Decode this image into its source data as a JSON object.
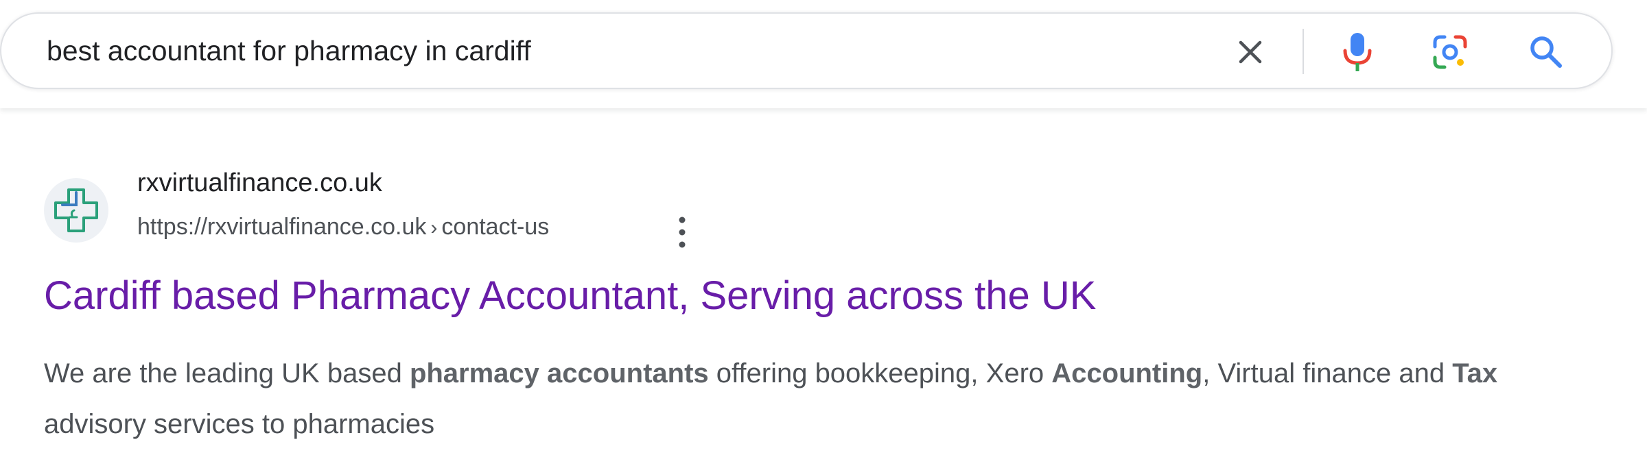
{
  "search": {
    "query": "best accountant for pharmacy in cardiff"
  },
  "icons": {
    "clear": "close-icon",
    "voice": "microphone-icon",
    "lens": "camera-lens-icon",
    "search": "search-icon",
    "more": "more-vert-icon",
    "favicon": "pharmacy-cross-icon"
  },
  "colors": {
    "visited_link": "#681da8",
    "search_icon": "#4285f4",
    "snippet_text": "#4d5156"
  },
  "result": {
    "site_name": "rxvirtualfinance.co.uk",
    "url_base": "https://rxvirtualfinance.co.uk",
    "url_separator": "›",
    "url_path": "contact-us",
    "title": "Cardiff based Pharmacy Accountant, Serving across the UK",
    "snippet": {
      "p1": "We are the leading UK based ",
      "b1": "pharmacy accountants",
      "p2": " offering bookkeeping, Xero ",
      "b2": "Accounting",
      "p3": ", Virtual finance and ",
      "b3": "Tax",
      "p4": " advisory services to pharmacies"
    }
  }
}
